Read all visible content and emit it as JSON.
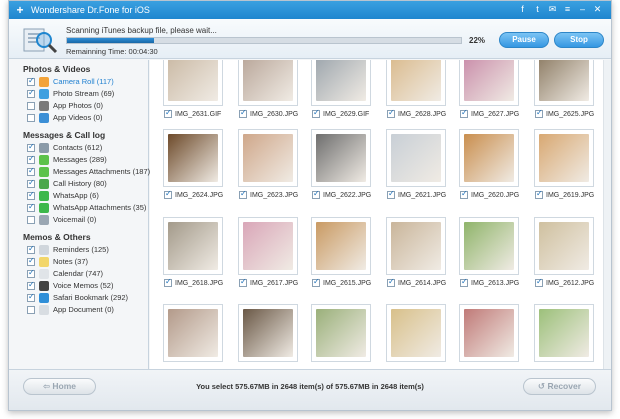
{
  "app": {
    "title": "Wondershare Dr.Fone for iOS"
  },
  "scan": {
    "message": "Scanning iTunes backup file, please wait...",
    "progress_percent": 22,
    "progress_label": "22%",
    "remaining": "Remainning Time: 00:04:30",
    "pause_label": "Pause",
    "stop_label": "Stop"
  },
  "sidebar": {
    "sections": [
      {
        "title": "Photos & Videos",
        "items": [
          {
            "label": "Camera Roll (117)",
            "checked": true,
            "selected": true,
            "icon": "camera-roll-icon"
          },
          {
            "label": "Photo Stream (69)",
            "checked": true,
            "icon": "photo-stream-icon"
          },
          {
            "label": "App Photos (0)",
            "checked": false,
            "icon": "app-photos-icon"
          },
          {
            "label": "App Videos (0)",
            "checked": false,
            "icon": "app-videos-icon"
          }
        ]
      },
      {
        "title": "Messages & Call log",
        "items": [
          {
            "label": "Contacts (612)",
            "checked": true,
            "icon": "contacts-icon"
          },
          {
            "label": "Messages (289)",
            "checked": true,
            "icon": "messages-icon"
          },
          {
            "label": "Messages Attachments (187)",
            "checked": true,
            "icon": "attachments-icon"
          },
          {
            "label": "Call History (80)",
            "checked": true,
            "icon": "call-history-icon"
          },
          {
            "label": "WhatsApp (6)",
            "checked": true,
            "icon": "whatsapp-icon"
          },
          {
            "label": "WhatsApp Attachments (35)",
            "checked": true,
            "icon": "whatsapp-attachments-icon"
          },
          {
            "label": "Voicemail (0)",
            "checked": false,
            "icon": "voicemail-icon"
          }
        ]
      },
      {
        "title": "Memos & Others",
        "items": [
          {
            "label": "Reminders (125)",
            "checked": true,
            "icon": "reminders-icon"
          },
          {
            "label": "Notes (37)",
            "checked": true,
            "icon": "notes-icon"
          },
          {
            "label": "Calendar (747)",
            "checked": true,
            "icon": "calendar-icon"
          },
          {
            "label": "Voice Memos (52)",
            "checked": true,
            "icon": "voice-memos-icon"
          },
          {
            "label": "Safari Bookmark (292)",
            "checked": true,
            "icon": "safari-icon"
          },
          {
            "label": "App Document (0)",
            "checked": false,
            "icon": "app-document-icon"
          }
        ]
      }
    ]
  },
  "photos": [
    {
      "name": "IMG_2631.GIF",
      "color": "#c9b8a3"
    },
    {
      "name": "IMG_2630.JPG",
      "color": "#b7a497"
    },
    {
      "name": "IMG_2629.GIF",
      "color": "#9aa3ab"
    },
    {
      "name": "IMG_2628.JPG",
      "color": "#d9b98a"
    },
    {
      "name": "IMG_2627.JPG",
      "color": "#c88aa8"
    },
    {
      "name": "IMG_2625.JPG",
      "color": "#8b7a62"
    },
    {
      "name": "IMG_2624.JPG",
      "color": "#6d4a2a"
    },
    {
      "name": "IMG_2623.JPG",
      "color": "#cfa78a"
    },
    {
      "name": "IMG_2622.JPG",
      "color": "#6e6e6e"
    },
    {
      "name": "IMG_2621.JPG",
      "color": "#c8cfd6"
    },
    {
      "name": "IMG_2620.JPG",
      "color": "#c98e4e"
    },
    {
      "name": "IMG_2619.JPG",
      "color": "#d8a872"
    },
    {
      "name": "IMG_2618.JPG",
      "color": "#a39a8a"
    },
    {
      "name": "IMG_2617.JPG",
      "color": "#d9a6b8"
    },
    {
      "name": "IMG_2615.JPG",
      "color": "#c99a63"
    },
    {
      "name": "IMG_2614.JPG",
      "color": "#c9b59a"
    },
    {
      "name": "IMG_2613.JPG",
      "color": "#8fb46a"
    },
    {
      "name": "IMG_2612.JPG",
      "color": "#cfc09f"
    },
    {
      "name": "",
      "color": "#b39a8a"
    },
    {
      "name": "",
      "color": "#6a5846"
    },
    {
      "name": "",
      "color": "#9ab07a"
    },
    {
      "name": "",
      "color": "#d8c08a"
    },
    {
      "name": "",
      "color": "#c07a78"
    },
    {
      "name": "",
      "color": "#9cc07a"
    }
  ],
  "footer": {
    "home_label": "Home",
    "recover_label": "Recover",
    "status": "You select 575.67MB in 2648 item(s) of 575.67MB in 2648 item(s)"
  }
}
